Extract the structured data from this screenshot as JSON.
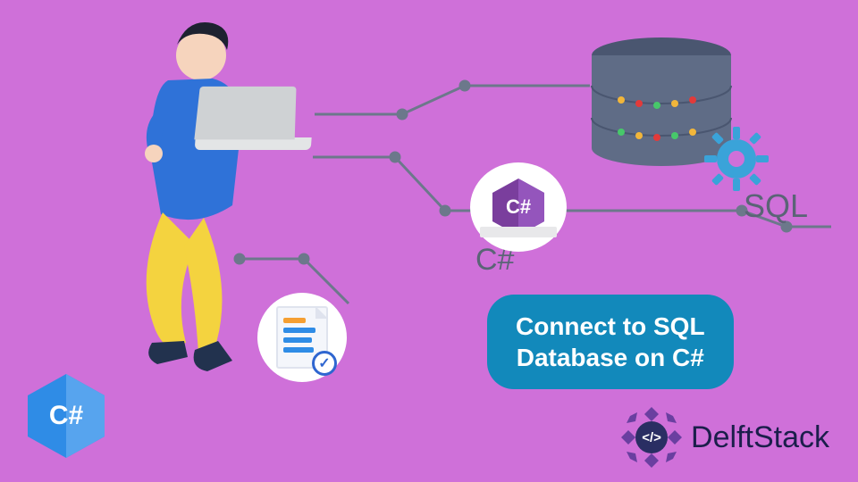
{
  "labels": {
    "sql": "SQL",
    "csharp": "C#",
    "logo_small": "C#",
    "logo_big": "C#"
  },
  "cta": {
    "line1": "Connect to SQL",
    "line2": "Database on C#"
  },
  "brand": {
    "name": "DelftStack",
    "mark_glyph": "</>"
  },
  "colors": {
    "bg": "#cf70d9",
    "accent": "#1289bb",
    "path": "#6c788b",
    "db_body": "#5f6c86",
    "db_top": "#4a5670",
    "gear": "#3aa3d9",
    "hex_purple": "#7a3e9d",
    "hex_blue": "#2f8ce6"
  }
}
